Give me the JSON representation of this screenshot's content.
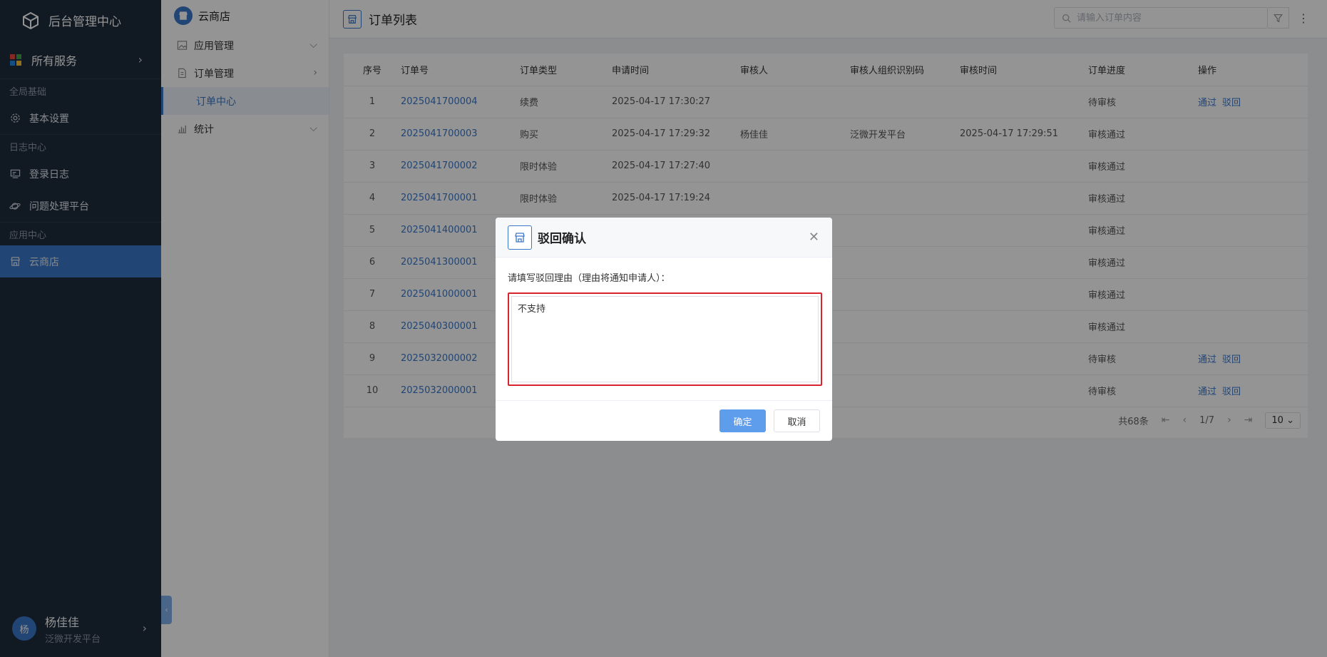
{
  "sidebar": {
    "brand": "后台管理中心",
    "all_services": "所有服务",
    "groups": [
      {
        "label": "全局基础",
        "items": [
          {
            "label": "基本设置",
            "icon": "gear-icon"
          }
        ]
      },
      {
        "label": "日志中心",
        "items": [
          {
            "label": "登录日志",
            "icon": "monitor-icon"
          },
          {
            "label": "问题处理平台",
            "icon": "planet-icon"
          }
        ]
      },
      {
        "label": "应用中心",
        "items": [
          {
            "label": "云商店",
            "icon": "store-icon",
            "active": true
          }
        ]
      }
    ],
    "user": {
      "avatar": "杨",
      "name": "杨佳佳",
      "org": "泛微开发平台"
    }
  },
  "submenu": {
    "title": "云商店",
    "items": [
      {
        "label": "应用管理"
      },
      {
        "label": "订单管理"
      },
      {
        "label": "订单中心"
      },
      {
        "label": "统计"
      }
    ]
  },
  "header": {
    "title": "订单列表",
    "search_placeholder": "请输入订单内容"
  },
  "table": {
    "columns": [
      "序号",
      "订单号",
      "订单类型",
      "申请时间",
      "审核人",
      "审核人组织识别码",
      "审核时间",
      "订单进度",
      "操作"
    ],
    "rows": [
      {
        "no": "1",
        "order": "2025041700004",
        "type": "续费",
        "applied": "2025-04-17 17:30:27",
        "auditor": "",
        "org": "",
        "audited": "",
        "status": "待审核",
        "a1": "通过",
        "a2": "驳回"
      },
      {
        "no": "2",
        "order": "2025041700003",
        "type": "购买",
        "applied": "2025-04-17 17:29:32",
        "auditor": "杨佳佳",
        "org": "泛微开发平台",
        "audited": "2025-04-17 17:29:51",
        "status": "审核通过",
        "a1": "",
        "a2": ""
      },
      {
        "no": "3",
        "order": "2025041700002",
        "type": "限时体验",
        "applied": "2025-04-17 17:27:40",
        "auditor": "",
        "org": "",
        "audited": "",
        "status": "审核通过",
        "a1": "",
        "a2": ""
      },
      {
        "no": "4",
        "order": "2025041700001",
        "type": "限时体验",
        "applied": "2025-04-17 17:19:24",
        "auditor": "",
        "org": "",
        "audited": "",
        "status": "审核通过",
        "a1": "",
        "a2": ""
      },
      {
        "no": "5",
        "order": "2025041400001",
        "type": "",
        "applied": "",
        "auditor": "",
        "org": "",
        "audited": "",
        "status": "审核通过",
        "a1": "",
        "a2": ""
      },
      {
        "no": "6",
        "order": "2025041300001",
        "type": "",
        "applied": "",
        "auditor": "",
        "org": "",
        "audited": "",
        "status": "审核通过",
        "a1": "",
        "a2": ""
      },
      {
        "no": "7",
        "order": "2025041000001",
        "type": "",
        "applied": "",
        "auditor": "",
        "org": "",
        "audited": "",
        "status": "审核通过",
        "a1": "",
        "a2": ""
      },
      {
        "no": "8",
        "order": "2025040300001",
        "type": "",
        "applied": "",
        "auditor": "",
        "org": "",
        "audited": "",
        "status": "审核通过",
        "a1": "",
        "a2": ""
      },
      {
        "no": "9",
        "order": "2025032000002",
        "type": "",
        "applied": "",
        "auditor": "",
        "org": "",
        "audited": "",
        "status": "待审核",
        "a1": "通过",
        "a2": "驳回"
      },
      {
        "no": "10",
        "order": "2025032000001",
        "type": "",
        "applied": "",
        "auditor": "",
        "org": "",
        "audited": "",
        "status": "待审核",
        "a1": "通过",
        "a2": "驳回"
      }
    ]
  },
  "pager": {
    "total": "共68条",
    "page": "1/7",
    "size": "10"
  },
  "dialog": {
    "title": "驳回确认",
    "label": "请填写驳回理由（理由将通知申请人）：",
    "value": "不支持",
    "confirm": "确定",
    "cancel": "取消"
  },
  "colors": {
    "sidebar": "#1e2b3d",
    "accent": "#3a77c9",
    "primary_button": "#5e9cec",
    "highlight": "#d9232e"
  }
}
